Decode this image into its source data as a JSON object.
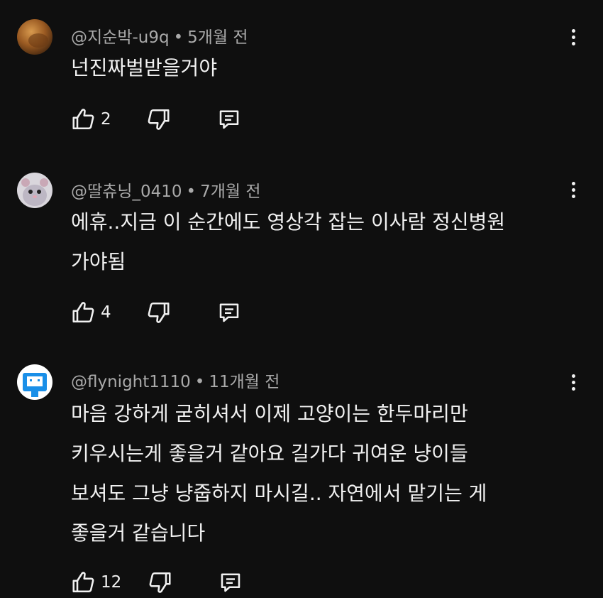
{
  "comments": [
    {
      "author": "@지순박-u9q",
      "separator": "•",
      "time": "5개월 전",
      "text": "넌진짜벌받을거야",
      "likes": "2",
      "avatar_icon": "avatar-brown-photo"
    },
    {
      "author": "@딸츄닝_0410",
      "separator": "•",
      "time": "7개월 전",
      "text": "에휴..지금 이 순간에도 영상각 잡는 이사람 정신병원\n가야됨",
      "likes": "4",
      "avatar_icon": "avatar-hamster"
    },
    {
      "author": "@flynight1110",
      "separator": "•",
      "time": "11개월 전",
      "text": "마음 강하게 굳히셔서 이제 고양이는 한두마리만\n키우시는게 좋을거 같아요 길가다 귀여운 냥이들\n보셔도 그냥 냥줍하지 마시길.. 자연에서 맡기는 게\n좋을거 같습니다",
      "likes": "12",
      "avatar_icon": "avatar-blue-robot"
    }
  ],
  "icons": {
    "like": "thumbs-up-icon",
    "dislike": "thumbs-down-icon",
    "reply": "reply-icon",
    "more": "more-vertical-icon"
  },
  "colors": {
    "background": "#0f0f0f",
    "text": "#f1f1f1",
    "meta": "#aaaaaa"
  }
}
